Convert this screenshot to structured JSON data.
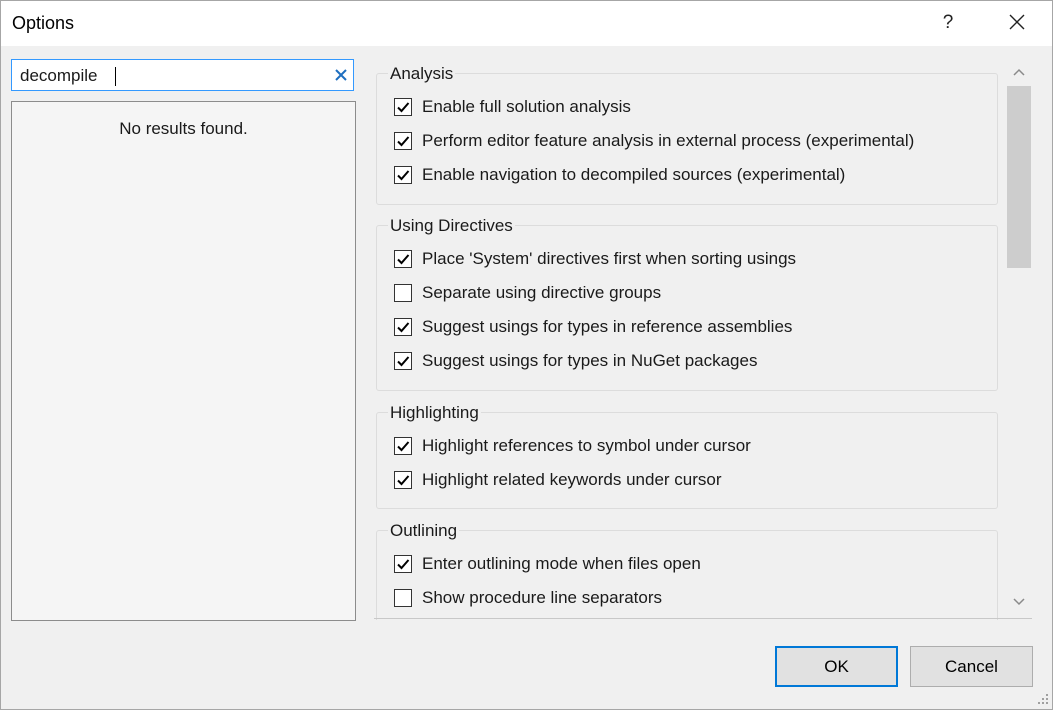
{
  "window": {
    "title": "Options",
    "help_label": "?"
  },
  "search": {
    "value": "decompile"
  },
  "tree": {
    "empty_message": "No results found."
  },
  "groups": [
    {
      "title": "Analysis",
      "items": [
        {
          "label": "Enable full solution analysis",
          "checked": true
        },
        {
          "label": "Perform editor feature analysis in external process (experimental)",
          "checked": true
        },
        {
          "label": "Enable navigation to decompiled sources (experimental)",
          "checked": true
        }
      ]
    },
    {
      "title": "Using Directives",
      "items": [
        {
          "label": "Place 'System' directives first when sorting usings",
          "checked": true
        },
        {
          "label": "Separate using directive groups",
          "checked": false
        },
        {
          "label": "Suggest usings for types in reference assemblies",
          "checked": true
        },
        {
          "label": "Suggest usings for types in NuGet packages",
          "checked": true
        }
      ]
    },
    {
      "title": "Highlighting",
      "items": [
        {
          "label": "Highlight references to symbol under cursor",
          "checked": true
        },
        {
          "label": "Highlight related keywords under cursor",
          "checked": true
        }
      ]
    },
    {
      "title": "Outlining",
      "items": [
        {
          "label": "Enter outlining mode when files open",
          "checked": true
        },
        {
          "label": "Show procedure line separators",
          "checked": false
        }
      ]
    }
  ],
  "buttons": {
    "ok": "OK",
    "cancel": "Cancel"
  },
  "colors": {
    "accent": "#0078d7",
    "focus_border": "#3399ff"
  }
}
